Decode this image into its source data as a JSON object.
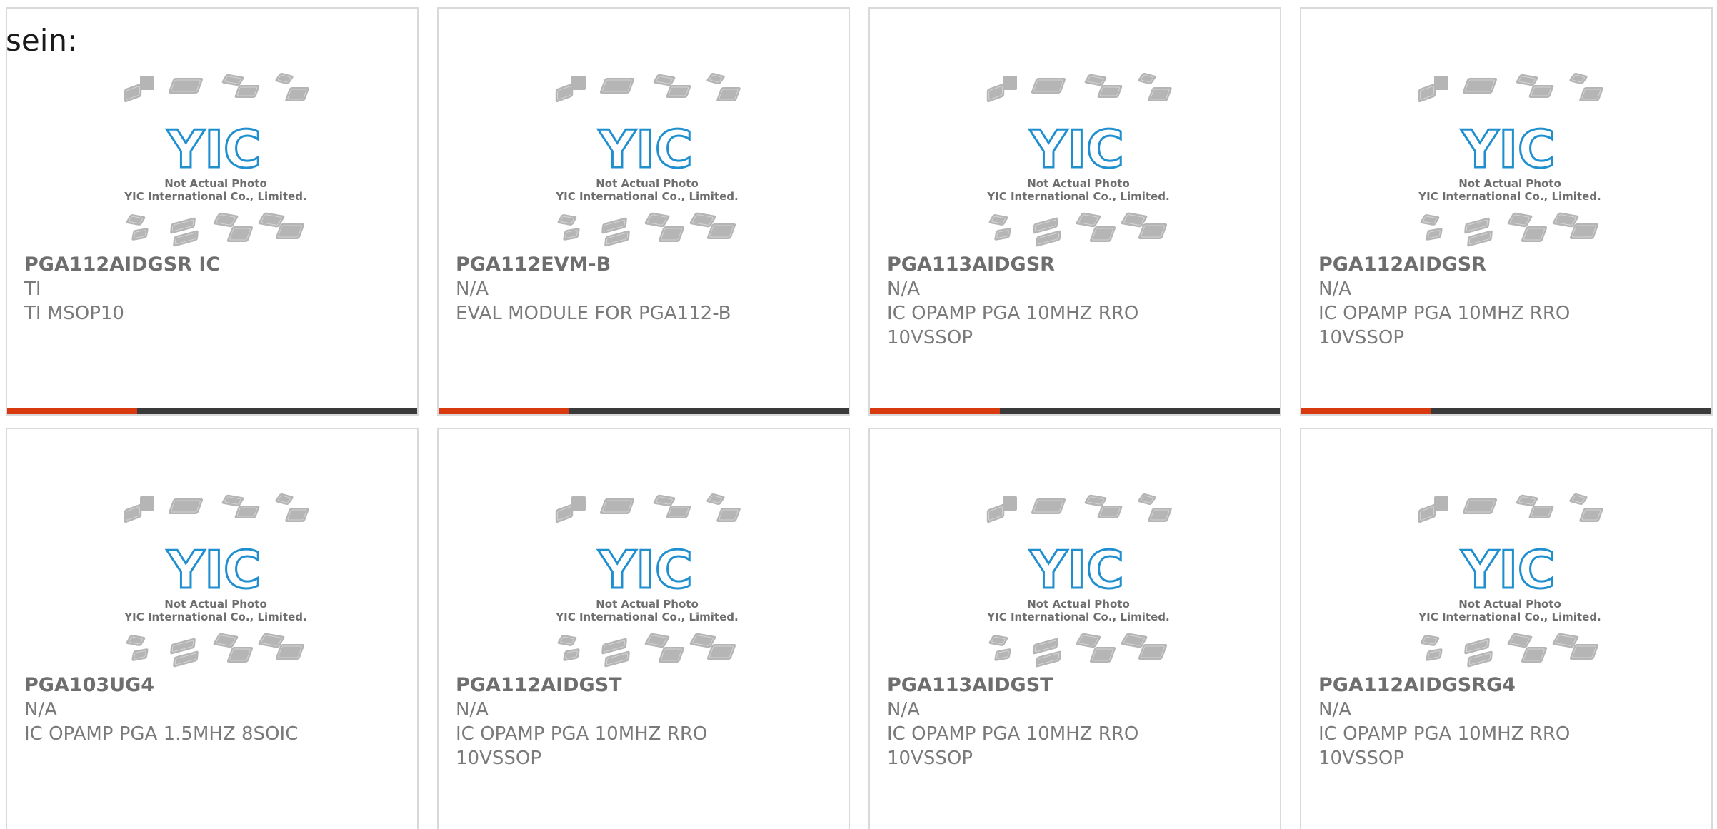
{
  "lead_text": "sein:",
  "placeholder_image": {
    "caption_line1": "Not Actual Photo",
    "caption_line2": "YIC International Co., Limited.",
    "logo_text": "YIC",
    "logo_color": "#1f8fd0",
    "chip_color": "#b5b5b5"
  },
  "colors": {
    "accent_bar": "#d9390f",
    "dark_bar": "#3a3a3a",
    "card_border": "#d9d9d9",
    "text": "#7a7a7a"
  },
  "products": [
    {
      "part": "PGA112AIDGSR IC",
      "brand": "TI",
      "desc_lines": [
        "TI MSOP10"
      ]
    },
    {
      "part": "PGA112EVM-B",
      "brand": "N/A",
      "desc_lines": [
        "EVAL MODULE FOR PGA112-B"
      ]
    },
    {
      "part": "PGA113AIDGSR",
      "brand": "N/A",
      "desc_lines": [
        "IC OPAMP PGA 10MHZ RRO",
        "10VSSOP"
      ]
    },
    {
      "part": "PGA112AIDGSR",
      "brand": "N/A",
      "desc_lines": [
        "IC OPAMP PGA 10MHZ RRO",
        "10VSSOP"
      ]
    },
    {
      "part": "PGA103UG4",
      "brand": "N/A",
      "desc_lines": [
        "IC OPAMP PGA 1.5MHZ 8SOIC"
      ]
    },
    {
      "part": "PGA112AIDGST",
      "brand": "N/A",
      "desc_lines": [
        "IC OPAMP PGA 10MHZ RRO",
        "10VSSOP"
      ]
    },
    {
      "part": "PGA113AIDGST",
      "brand": "N/A",
      "desc_lines": [
        "IC OPAMP PGA 10MHZ RRO",
        "10VSSOP"
      ]
    },
    {
      "part": "PGA112AIDGSRG4",
      "brand": "N/A",
      "desc_lines": [
        "IC OPAMP PGA 10MHZ RRO",
        "10VSSOP"
      ]
    }
  ]
}
